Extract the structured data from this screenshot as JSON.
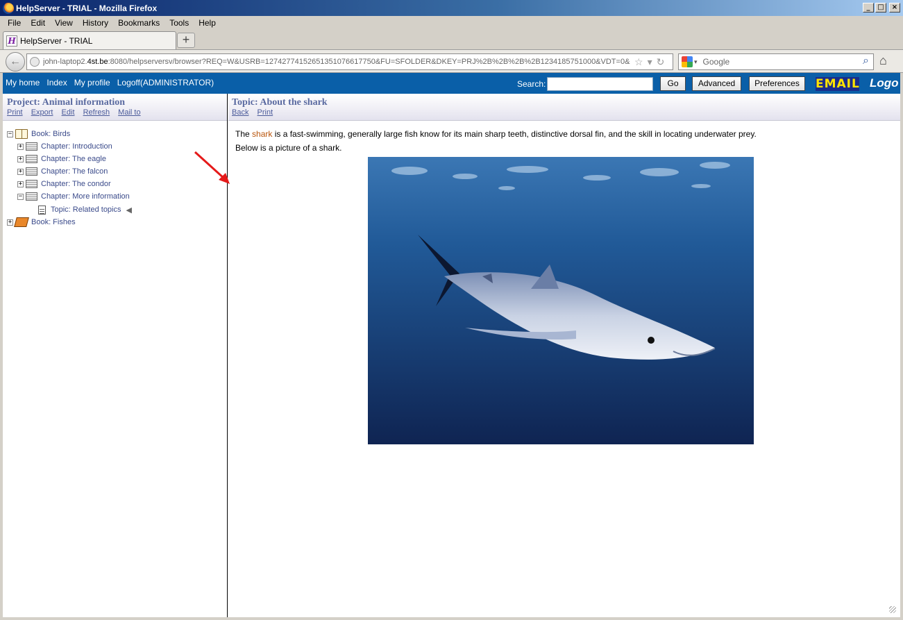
{
  "window": {
    "title": "HelpServer - TRIAL - Mozilla Firefox"
  },
  "menu": {
    "file": "File",
    "edit": "Edit",
    "view": "View",
    "history": "History",
    "bookmarks": "Bookmarks",
    "tools": "Tools",
    "help": "Help"
  },
  "tab": {
    "title": "HelpServer - TRIAL"
  },
  "address": {
    "host_prefix": "john-laptop2.",
    "host_domain": "4st.be",
    "rest": ":8080/helpserversv/browser?REQ=W&USRB=1274277415265135107661775­0&FU=SFOLDER&DKEY=PRJ%2B%2B%2B%2B1234185751000&VDT=0&"
  },
  "websearch": {
    "placeholder": "Google"
  },
  "topbar": {
    "links": [
      "My home",
      "Index",
      "My profile",
      "Logoff(ADMINISTRATOR)"
    ],
    "search_label": "Search:",
    "go": "Go",
    "advanced": "Advanced",
    "preferences": "Preferences",
    "email": "EMAIL",
    "logo": "Logo"
  },
  "project": {
    "title": "Project: Animal information",
    "links": [
      "Print",
      "Export",
      "Edit",
      "Refresh",
      "Mail to"
    ]
  },
  "tree": {
    "book_birds": "Book: Birds",
    "ch_intro": "Chapter: Introduction",
    "ch_eagle": "Chapter: The eagle",
    "ch_falcon": "Chapter: The falcon",
    "ch_condor": "Chapter: The condor",
    "ch_more": "Chapter: More information",
    "topic_related": "Topic: Related topics",
    "book_fishes": "Book: Fishes"
  },
  "topic": {
    "title": "Topic: About the shark",
    "links": [
      "Back",
      "Print"
    ],
    "para_before": "The ",
    "para_highlight": "shark",
    "para_after": " is a fast-swimming, generally large fish know for its main sharp teeth, distinctive dorsal fin, and the skill in locating underwater prey.",
    "line2": "Below is a picture of a shark."
  }
}
